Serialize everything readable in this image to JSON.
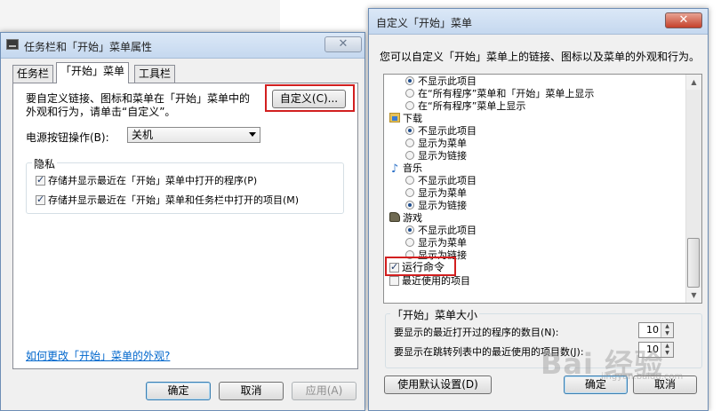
{
  "left_window": {
    "title": "任务栏和「开始」菜单属性",
    "tabs": [
      "任务栏",
      "「开始」菜单",
      "工具栏"
    ],
    "description_line1": "要自定义链接、图标和菜单在「开始」菜单中的",
    "description_line2": "外观和行为，请单击“自定义”。",
    "customize_button": "自定义(C)...",
    "power_label": "电源按钮操作(B):",
    "power_value": "关机",
    "privacy_label": "隐私",
    "privacy_option1": "存储并显示最近在「开始」菜单中打开的程序(P)",
    "privacy_option2": "存储并显示最近在「开始」菜单和任务栏中打开的项目(M)",
    "help_link": "如何更改「开始」菜单的外观?",
    "ok_button": "确定",
    "cancel_button": "取消",
    "apply_button": "应用(A)"
  },
  "right_window": {
    "title": "自定义「开始」菜单",
    "description": "您可以自定义「开始」菜单上的链接、图标以及菜单的外观和行为。",
    "list_items": [
      "不显示此项目",
      "在“所有程序”菜单和「开始」菜单上显示",
      "在“所有程序”菜单上显示",
      "下载",
      "不显示此项目",
      "显示为菜单",
      "显示为链接",
      "音乐",
      "不显示此项目",
      "显示为菜单",
      "显示为链接",
      "游戏",
      "不显示此项目",
      "显示为菜单",
      "显示为链接",
      "运行命令",
      "最近使用的项目"
    ],
    "size_group_label": "「开始」菜单大小",
    "recent_programs_label": "要显示的最近打开过的程序的数目(N):",
    "recent_programs_value": "10",
    "jump_list_label": "要显示在跳转列表中的最近使用的项目数(J):",
    "jump_list_value": "10",
    "default_button": "使用默认设置(D)",
    "ok_button": "确定",
    "cancel_button": "取消"
  },
  "watermark": {
    "text": "Bai 经验",
    "sub": "jingyan.baidu.com"
  }
}
